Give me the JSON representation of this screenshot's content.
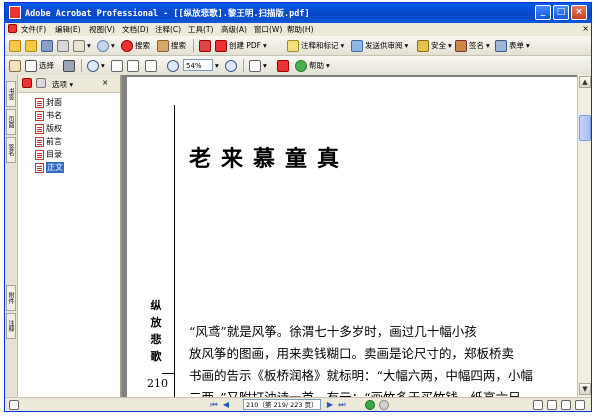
{
  "window": {
    "title": "Adobe Acrobat Professional - [[纵放悲歌].黎王明.扫描版.pdf]",
    "min_label": "_",
    "max_label": "□",
    "close_label": "×"
  },
  "menubar": {
    "items": [
      "文件(F)",
      "编辑(E)",
      "视图(V)",
      "文档(D)",
      "注释(C)",
      "工具(T)",
      "高级(A)",
      "窗口(W)",
      "帮助(H)"
    ],
    "close_doc": "×"
  },
  "toolbar1": {
    "record_label": "搜索",
    "search_label": "搜索",
    "create_pdf": "创建 PDF",
    "review": "注释和标记",
    "send_review": "发送供审阅",
    "secure": "安全",
    "sign": "签名",
    "forms": "表单"
  },
  "toolbar2": {
    "select_label": "选择",
    "zoom_value": "54%",
    "help_label": "帮助"
  },
  "nav_panel": {
    "options_label": "选项",
    "close_label": "×",
    "tabs": [
      "书签",
      "页面",
      "签名"
    ],
    "lower_tabs": [
      "附件",
      "注释"
    ],
    "bookmarks": [
      "封面",
      "书名",
      "版权",
      "前言",
      "目录",
      "正文"
    ],
    "selected_index": 5
  },
  "document": {
    "chapter_title": "老来慕童真",
    "side_title": "纵放悲歌",
    "page_number": "210",
    "paragraph_lines": [
      "“风鸢”就是风筝。徐渭七十多岁时，画过几十幅小孩",
      "放风筝的图画，用来卖钱糊口。卖画是论尺寸的，郑板桥卖",
      "书画的告示《板桥润格》就标明：“大幅六两，中幅四两，小幅",
      "二两。”又附打油诗一首，有云：“画竹多于买竹钱，纸高六尺"
    ]
  },
  "statusbar": {
    "page_field": "210（第 219/ 223 页）"
  }
}
